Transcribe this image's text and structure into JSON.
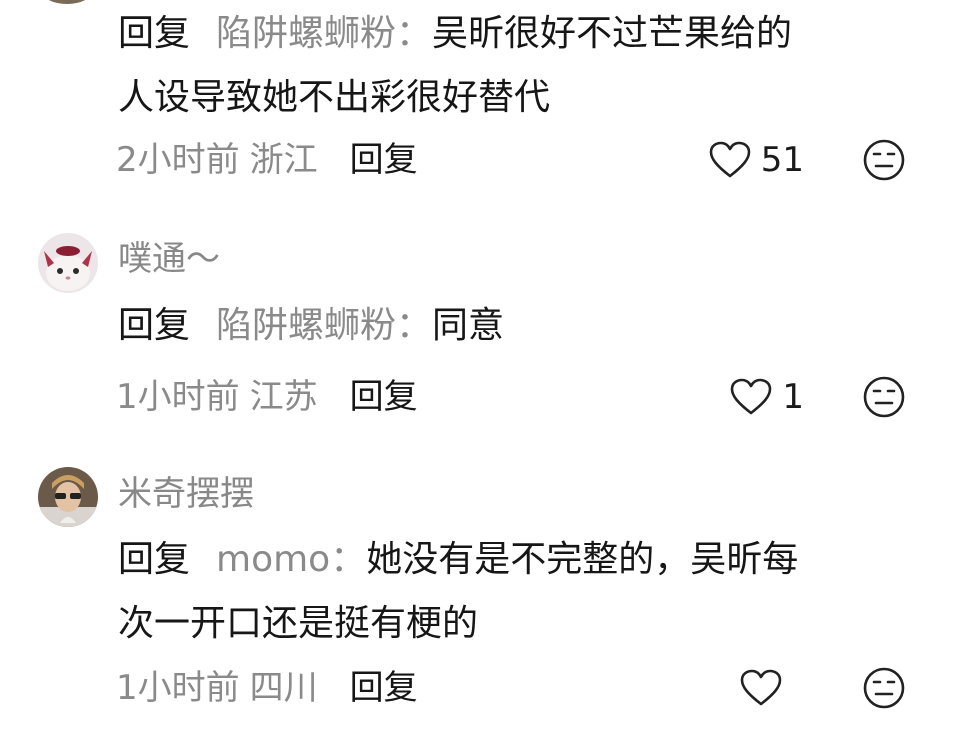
{
  "comments": [
    {
      "username": "",
      "reply_label": "回复",
      "reply_target": "陷阱螺蛳粉",
      "colon": "：",
      "text_line1": "吴昕很好不过芒果给的",
      "text_line2": "人设导致她不出彩很好替代",
      "time": "2小时前",
      "location": "浙江",
      "reply_button": "回复",
      "likes": "51"
    },
    {
      "username": "噗通～",
      "reply_label": "回复",
      "reply_target": "陷阱螺蛳粉",
      "colon": "：",
      "text_line1": "同意",
      "time": "1小时前",
      "location": "江苏",
      "reply_button": "回复",
      "likes": "1"
    },
    {
      "username": "米奇摆摆",
      "reply_label": "回复",
      "reply_target": "momo",
      "colon": "：",
      "text_line1": "她没有是不完整的，吴昕每",
      "text_line2": "次一开口还是挺有梗的",
      "time": "1小时前",
      "location": "四川",
      "reply_button": "回复",
      "likes": ""
    }
  ],
  "icons": {
    "like": "heart-outline-icon",
    "emoji": "neutral-face-icon"
  },
  "colors": {
    "text": "#161616",
    "muted": "#8a8a8a"
  }
}
